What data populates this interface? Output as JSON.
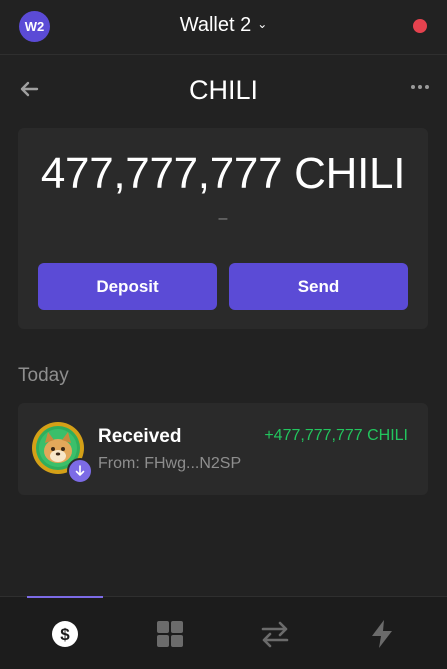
{
  "header": {
    "avatar_label": "W2",
    "wallet_name": "Wallet 2",
    "chevron": "⌄",
    "status_color": "#e5424e"
  },
  "token": {
    "title": "CHILI",
    "back_icon": "arrow-left-icon",
    "more_icon": "more-horizontal-icon"
  },
  "balance": {
    "amount": "477,777,777 CHILI",
    "fiat": "–"
  },
  "actions": {
    "deposit_label": "Deposit",
    "send_label": "Send",
    "accent": "#5b4bd6"
  },
  "activity": {
    "section_label": "Today",
    "transactions": [
      {
        "title": "Received",
        "from": "From: FHwg...N2SP",
        "amount": "+477,777,777 CHILI",
        "amount_color": "#22c55e",
        "icon": "received-arrow-icon"
      }
    ]
  },
  "nav": {
    "items": [
      {
        "icon": "dollar-icon",
        "active": true
      },
      {
        "icon": "grid-icon",
        "active": false
      },
      {
        "icon": "swap-icon",
        "active": false
      },
      {
        "icon": "lightning-icon",
        "active": false
      }
    ]
  }
}
